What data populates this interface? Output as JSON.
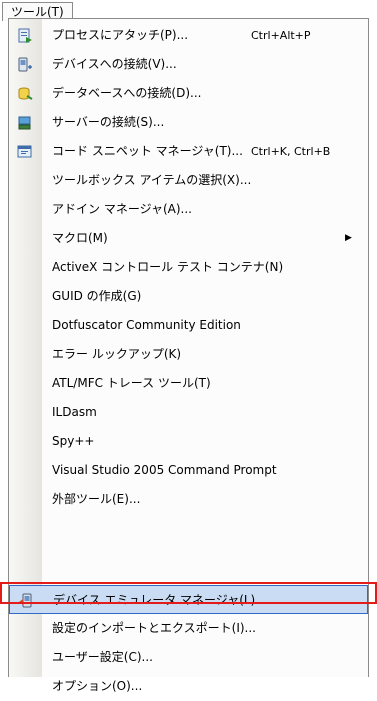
{
  "menubar": {
    "title": "ツール(T)"
  },
  "menu": {
    "items": [
      {
        "label": "プロセスにアタッチ(P)...",
        "shortcut": "Ctrl+Alt+P",
        "icon": "attach-process-icon"
      },
      {
        "label": "デバイスへの接続(V)...",
        "shortcut": "",
        "icon": "device-connect-icon"
      },
      {
        "label": "データベースへの接続(D)...",
        "shortcut": "",
        "icon": "database-connect-icon"
      },
      {
        "label": "サーバーの接続(S)...",
        "shortcut": "",
        "icon": "server-connect-icon"
      },
      {
        "label": "コード スニペット マネージャ(T)...",
        "shortcut": "Ctrl+K, Ctrl+B",
        "icon": "code-snippet-icon"
      },
      {
        "label": "ツールボックス アイテムの選択(X)...",
        "shortcut": "",
        "icon": ""
      },
      {
        "label": "アドイン マネージャ(A)...",
        "shortcut": "",
        "icon": ""
      },
      {
        "label": "マクロ(M)",
        "shortcut": "",
        "icon": "",
        "submenu": true
      },
      {
        "label": "ActiveX コントロール テスト コンテナ(N)",
        "shortcut": "",
        "icon": ""
      },
      {
        "label": "GUID の作成(G)",
        "shortcut": "",
        "icon": ""
      },
      {
        "label": "Dotfuscator Community Edition",
        "shortcut": "",
        "icon": ""
      },
      {
        "label": "エラー ルックアップ(K)",
        "shortcut": "",
        "icon": ""
      },
      {
        "label": "ATL/MFC トレース ツール(T)",
        "shortcut": "",
        "icon": ""
      },
      {
        "label": "ILDasm",
        "shortcut": "",
        "icon": ""
      },
      {
        "label": "Spy++",
        "shortcut": "",
        "icon": ""
      },
      {
        "label": "Visual Studio 2005 Command Prompt",
        "shortcut": "",
        "icon": ""
      },
      {
        "label": "外部ツール(E)...",
        "shortcut": "",
        "icon": ""
      },
      {
        "label": "デバイス エミュレータ マネージャ(L)...",
        "shortcut": "",
        "icon": "device-emulator-icon",
        "highlighted": true
      },
      {
        "label": "設定のインポートとエクスポート(I)...",
        "shortcut": "",
        "icon": ""
      },
      {
        "label": "ユーザー設定(C)...",
        "shortcut": "",
        "icon": ""
      },
      {
        "label": "オプション(O)...",
        "shortcut": "",
        "icon": ""
      }
    ]
  }
}
